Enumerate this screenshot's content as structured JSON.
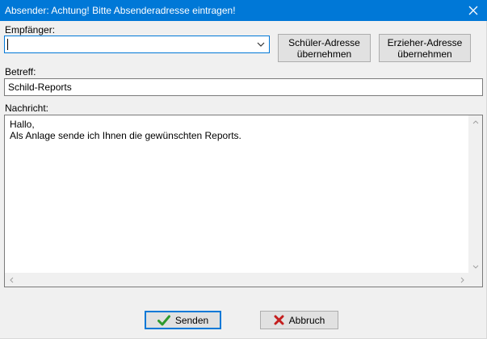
{
  "window": {
    "title": "Absender: Achtung! Bitte Absenderadresse eintragen!"
  },
  "recipient": {
    "label": "Empfänger:",
    "value": ""
  },
  "buttons": {
    "student_address": "Schüler-Adresse übernehmen",
    "educator_address": "Erzieher-Adresse übernehmen",
    "send": "Senden",
    "cancel": "Abbruch"
  },
  "subject": {
    "label": "Betreff:",
    "value": "Schild-Reports"
  },
  "message": {
    "label": "Nachricht:",
    "text": "Hallo,\nAls Anlage sende ich Ihnen die gewünschten Reports."
  },
  "colors": {
    "titlebar": "#0078d7",
    "send_icon": "#2e9a2e",
    "cancel_icon": "#c41e1e"
  }
}
